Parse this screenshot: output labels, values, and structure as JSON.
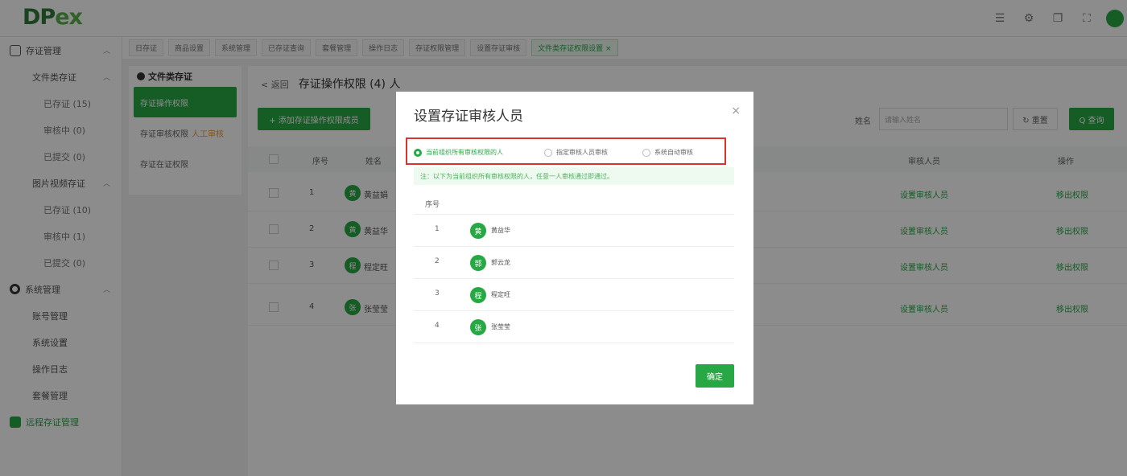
{
  "app": {
    "logo_main": "DP",
    "logo_ex": "ex"
  },
  "header": {
    "icons": [
      "list-icon",
      "settings-icon",
      "layers-icon",
      "fullscreen-icon"
    ]
  },
  "sidebar": {
    "items": [
      {
        "label": "存证管理",
        "level": 1
      },
      {
        "label": "文件类存证",
        "level": 2
      },
      {
        "label": "已存证 (15)",
        "level": 3
      },
      {
        "label": "审核中 (0)",
        "level": 3
      },
      {
        "label": "已提交 (0)",
        "level": 3
      },
      {
        "label": "图片视频存证",
        "level": 2
      },
      {
        "label": "已存证 (10)",
        "level": 3
      },
      {
        "label": "审核中 (1)",
        "level": 3
      },
      {
        "label": "已提交 (0)",
        "level": 3
      },
      {
        "label": "系统管理",
        "level": 1
      },
      {
        "label": "账号管理",
        "level": 2
      },
      {
        "label": "系统设置",
        "level": 2
      },
      {
        "label": "操作日志",
        "level": 2
      },
      {
        "label": "套餐管理",
        "level": 2
      },
      {
        "label": "远程存证管理",
        "level": 1
      }
    ]
  },
  "tabs": [
    "日存证",
    "商品设置",
    "系统管理",
    "已存证查询",
    "套餐管理",
    "操作日志",
    "存证权限管理",
    "设置存证审核",
    "文件类存证权限设置 ×"
  ],
  "submenu": {
    "title": "文件类存证",
    "items": [
      "存证操作权限",
      "存证审核权限",
      "存证在证权限"
    ],
    "tag": "人工审核"
  },
  "main": {
    "back": "< 返回",
    "title": "存证操作权限 (4) 人",
    "add_button": "+ 添加存证操作权限成员",
    "search_label": "姓名",
    "search_placeholder": "请输入姓名",
    "reset_button": "↻ 重置",
    "query_button": "Q 查询",
    "columns": [
      "序号",
      "姓名",
      "审核人员",
      "操作"
    ],
    "rows": [
      {
        "idx": "1",
        "avatar": "黄",
        "name": "黄益娟",
        "approver": "设置审核人员",
        "action": "移出权限"
      },
      {
        "idx": "2",
        "avatar": "黄",
        "name": "黄益华",
        "approver": "设置审核人员",
        "action": "移出权限"
      },
      {
        "idx": "3",
        "avatar": "程",
        "name": "程定旺",
        "approver": "设置审核人员",
        "action": "移出权限"
      },
      {
        "idx": "4",
        "avatar": "张",
        "name": "张莹莹",
        "approver": "设置审核人员",
        "action": "移出权限"
      }
    ]
  },
  "modal": {
    "title": "设置存证审核人员",
    "close": "×",
    "options": [
      {
        "label": "当前组织所有审核权限的人",
        "checked": true
      },
      {
        "label": "指定审核人员审核",
        "checked": false
      },
      {
        "label": "系统自动审核",
        "checked": false
      }
    ],
    "note": "注：以下为当前组织所有审核权限的人，任意一人审核通过即通过。",
    "col_index": "序号",
    "rows": [
      {
        "idx": "1",
        "avatar": "黄",
        "name": "黄益华"
      },
      {
        "idx": "2",
        "avatar": "郭",
        "name": "郭云龙"
      },
      {
        "idx": "3",
        "avatar": "程",
        "name": "程定旺"
      },
      {
        "idx": "4",
        "avatar": "张",
        "name": "张莹莹"
      }
    ],
    "confirm": "确定"
  },
  "colors": {
    "accent": "#27a844",
    "highlight_border": "#d9342b"
  }
}
